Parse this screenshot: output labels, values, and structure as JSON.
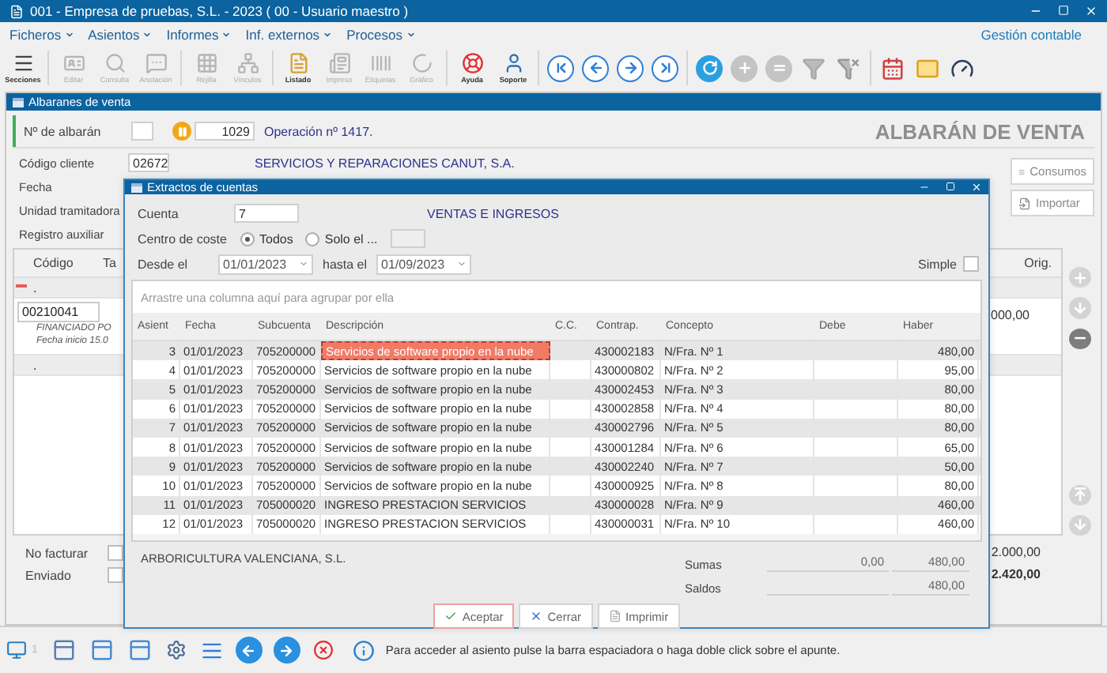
{
  "window": {
    "title": "001 - Empresa de pruebas, S.L. - 2023 ( 00 - Usuario maestro )"
  },
  "menu": [
    "Ficheros",
    "Asientos",
    "Informes",
    "Inf. externos",
    "Procesos"
  ],
  "module": "Gestión contable",
  "toolbar": [
    {
      "label": "Secciones",
      "disabled": false
    },
    {
      "label": "Editar",
      "disabled": true
    },
    {
      "label": "Consulta",
      "disabled": true
    },
    {
      "label": "Anotación",
      "disabled": true
    },
    {
      "label": "Rejilla",
      "disabled": true
    },
    {
      "label": "Vínculos",
      "disabled": true
    },
    {
      "label": "Listado",
      "disabled": false
    },
    {
      "label": "Impreso",
      "disabled": true
    },
    {
      "label": "Etiquetas",
      "disabled": true
    },
    {
      "label": "Gráfico",
      "disabled": true
    },
    {
      "label": "Ayuda",
      "disabled": false
    },
    {
      "label": "Soporte",
      "disabled": false
    }
  ],
  "document": {
    "title": "Albaranes de venta",
    "heading": "ALBARÁN DE VENTA",
    "number_label": "Nº de albarán",
    "number": "1029",
    "operation": "Operación nº 1417.",
    "client_label": "Código cliente",
    "client_code": "02672",
    "client_name": "SERVICIOS Y REPARACIONES CANUT, S.A.",
    "labels": [
      "Fecha",
      "Unidad tramitadora",
      "Registro auxiliar"
    ],
    "buttons": [
      "Consumos",
      "Importar"
    ],
    "grid": {
      "columns": [
        "Código",
        "Ta",
        "Orig."
      ],
      "rows": [
        {
          "code": "."
        },
        {
          "code": "00210041",
          "notes": [
            "FINANCIADO PO",
            "Fecha inicio 15.0"
          ],
          "amount": "000,00"
        },
        {
          "code": "."
        }
      ]
    },
    "flags": [
      {
        "label": "No facturar",
        "checked": false
      },
      {
        "label": "Enviado",
        "checked": false
      }
    ],
    "totals": [
      "2.000,00",
      "2.420,00"
    ]
  },
  "dialog": {
    "title": "Extractos de cuentas",
    "account_label": "Cuenta",
    "account": "7",
    "account_name": "VENTAS E INGRESOS",
    "cost_center_label": "Centro de coste",
    "cost_center_options": [
      {
        "label": "Todos",
        "selected": true
      },
      {
        "label": "Solo el ...",
        "selected": false
      }
    ],
    "from_label": "Desde el",
    "from": "01/01/2023",
    "to_label": "hasta el",
    "to": "01/09/2023",
    "simple": {
      "label": "Simple",
      "checked": false
    },
    "group_hint": "Arrastre una columna aquí para agrupar por ella",
    "columns": [
      "Asient",
      "Fecha",
      "Subcuenta",
      "Descripción",
      "C.C.",
      "Contrap.",
      "Concepto",
      "Debe",
      "Haber"
    ],
    "rows": [
      {
        "asiento": "3",
        "fecha": "01/01/2023",
        "subcuenta": "705200000",
        "descripcion": "Servicios de software propio en la nube",
        "contrap": "430002183",
        "concepto": "N/Fra. Nº 1",
        "haber": "480,00",
        "selected": true
      },
      {
        "asiento": "4",
        "fecha": "01/01/2023",
        "subcuenta": "705200000",
        "descripcion": "Servicios de software propio en la nube",
        "contrap": "430000802",
        "concepto": "N/Fra. Nº 2",
        "haber": "95,00",
        "selected": false
      },
      {
        "asiento": "5",
        "fecha": "01/01/2023",
        "subcuenta": "705200000",
        "descripcion": "Servicios de software propio en la nube",
        "contrap": "430002453",
        "concepto": "N/Fra. Nº 3",
        "haber": "80,00",
        "selected": false
      },
      {
        "asiento": "6",
        "fecha": "01/01/2023",
        "subcuenta": "705200000",
        "descripcion": "Servicios de software propio en la nube",
        "contrap": "430002858",
        "concepto": "N/Fra. Nº 4",
        "haber": "80,00",
        "selected": false
      },
      {
        "asiento": "7",
        "fecha": "01/01/2023",
        "subcuenta": "705200000",
        "descripcion": "Servicios de software propio en la nube",
        "contrap": "430002796",
        "concepto": "N/Fra. Nº 5",
        "haber": "80,00",
        "selected": false
      },
      {
        "asiento": "8",
        "fecha": "01/01/2023",
        "subcuenta": "705200000",
        "descripcion": "Servicios de software propio en la nube",
        "contrap": "430001284",
        "concepto": "N/Fra. Nº 6",
        "haber": "65,00",
        "selected": false
      },
      {
        "asiento": "9",
        "fecha": "01/01/2023",
        "subcuenta": "705200000",
        "descripcion": "Servicios de software propio en la nube",
        "contrap": "430002240",
        "concepto": "N/Fra. Nº 7",
        "haber": "50,00",
        "selected": false
      },
      {
        "asiento": "10",
        "fecha": "01/01/2023",
        "subcuenta": "705200000",
        "descripcion": "Servicios de software propio en la nube",
        "contrap": "430000925",
        "concepto": "N/Fra. Nº 8",
        "haber": "80,00",
        "selected": false
      },
      {
        "asiento": "11",
        "fecha": "01/01/2023",
        "subcuenta": "705000020",
        "descripcion": "INGRESO PRESTACION SERVICIOS",
        "contrap": "430000028",
        "concepto": "N/Fra. Nº 9",
        "haber": "460,00",
        "selected": false
      },
      {
        "asiento": "12",
        "fecha": "01/01/2023",
        "subcuenta": "705000020",
        "descripcion": "INGRESO PRESTACION SERVICIOS",
        "contrap": "430000031",
        "concepto": "N/Fra. Nº 10",
        "haber": "460,00",
        "selected": false
      }
    ],
    "account_holder": "ARBORICULTURA VALENCIANA, S.L.",
    "sums": {
      "label": "Sumas",
      "debe": "0,00",
      "haber": "480,00"
    },
    "balance": {
      "label": "Saldos",
      "haber": "480,00"
    },
    "buttons": [
      {
        "label": "Aceptar",
        "focused": true
      },
      {
        "label": "Cerrar",
        "focused": false
      },
      {
        "label": "Imprimir",
        "focused": false
      }
    ]
  },
  "status": {
    "counter": "1",
    "message": "Para acceder al asiento pulse la barra espaciadora o haga doble click sobre el apunte."
  }
}
